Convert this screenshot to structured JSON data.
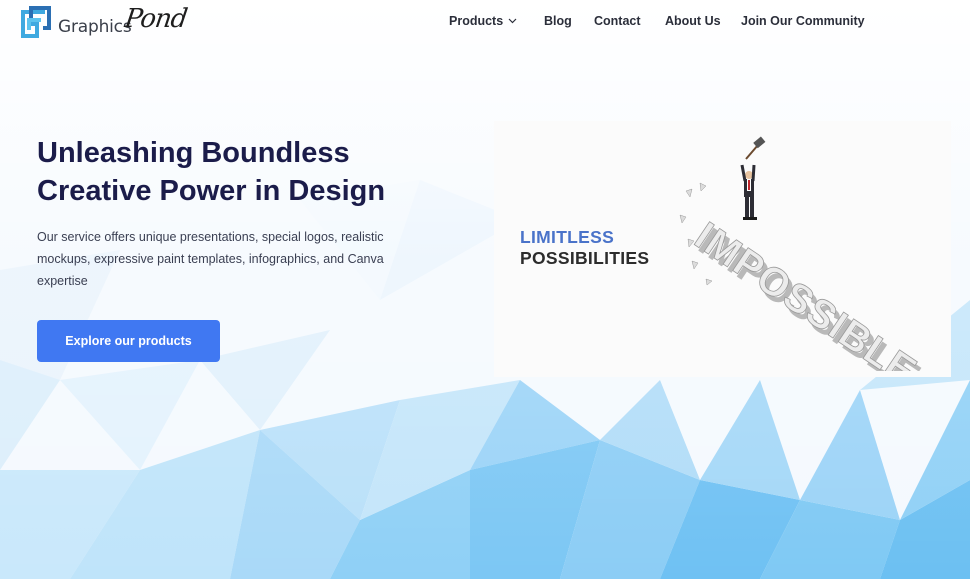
{
  "brand": {
    "name": "Graphics",
    "script": "Pond"
  },
  "nav": {
    "products": "Products",
    "blog": "Blog",
    "contact": "Contact",
    "about": "About Us",
    "community": "Join Our Community"
  },
  "hero": {
    "title_line1": "Unleashing Boundless",
    "title_line2": "Creative Power in Design",
    "description": "Our service offers unique presentations, special logos, realistic mockups, expressive paint templates, infographics, and Canva expertise",
    "cta": "Explore our products"
  },
  "hero_image": {
    "line1": "LIMITLESS",
    "line2": "POSSIBILITIES",
    "word": "IMPOSSIBLE"
  },
  "colors": {
    "accent": "#4078f2",
    "title": "#1b1c4a",
    "limitless": "#4a73c9"
  },
  "icons": {
    "logo": "graphics-pond-logo-icon",
    "products_dropdown": "chevron-down-icon"
  }
}
